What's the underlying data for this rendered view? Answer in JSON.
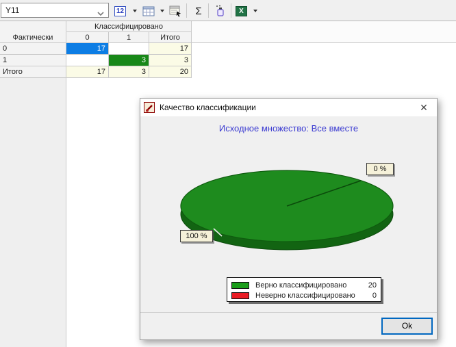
{
  "toolbar": {
    "field_value": "Y11",
    "num_format_label": "12",
    "sigma_label": "Σ",
    "excel_label": "X"
  },
  "table": {
    "group_header": "Классифицировано",
    "row_header": "Фактически",
    "col_headers": [
      "0",
      "1",
      "Итого"
    ],
    "rows": [
      {
        "label": "0",
        "cells": [
          "17",
          "",
          "17"
        ]
      },
      {
        "label": "1",
        "cells": [
          "",
          "3",
          "3"
        ]
      },
      {
        "label": "Итого",
        "cells": [
          "17",
          "3",
          "20"
        ]
      }
    ],
    "highlight_colors": {
      "selected_blue": "#0d7de4",
      "selected_green": "#188818"
    }
  },
  "dialog": {
    "title": "Качество классификации",
    "close_glyph": "✕",
    "subtitle": "Исходное множество: Все вместе",
    "ok_label": "Ok",
    "legend": {
      "items": [
        {
          "label": "Верно классифицировано",
          "value": "20",
          "color": "#1b9e1b"
        },
        {
          "label": "Неверно классифицировано",
          "value": "0",
          "color": "#ea1c24"
        }
      ]
    }
  },
  "chart_data": {
    "type": "pie",
    "style": "3d-pie",
    "title": "Исходное множество: Все вместе",
    "slices": [
      {
        "label": "Верно классифицировано",
        "value": 20,
        "pct_label": "100 %",
        "color": "#1e8b1e"
      },
      {
        "label": "Неверно классифицировано",
        "value": 0,
        "pct_label": "0 %",
        "color": "#ea1c24"
      }
    ],
    "legend_position": "bottom-center"
  }
}
